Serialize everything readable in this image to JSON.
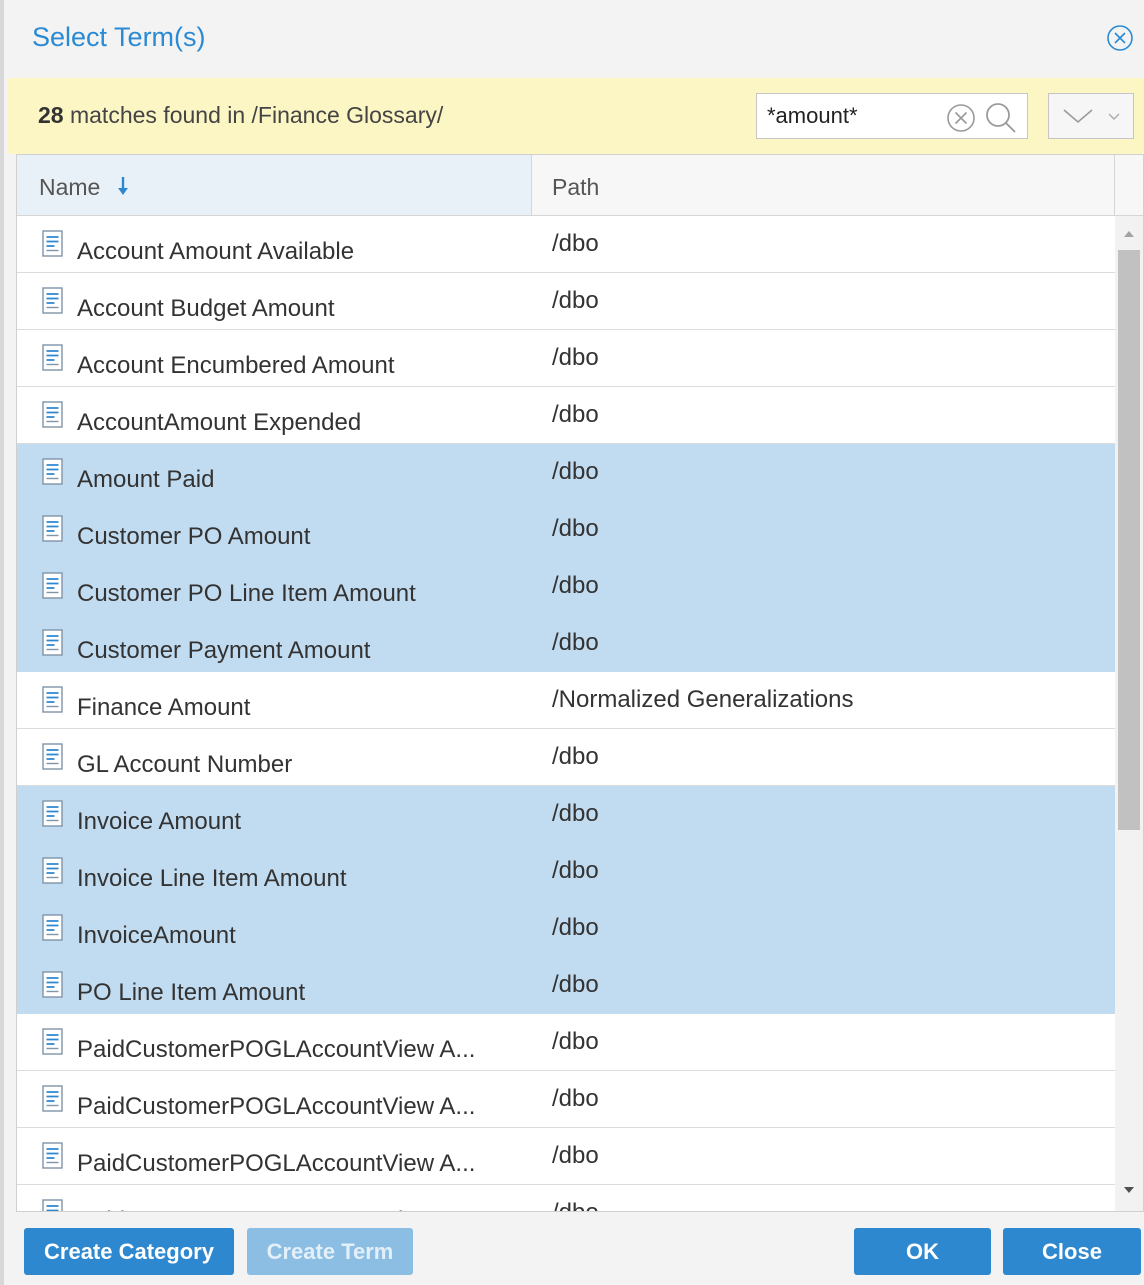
{
  "dialog": {
    "title": "Select Term(s)"
  },
  "info": {
    "count": "28",
    "text": " matches found in /Finance Glossary/"
  },
  "search": {
    "value": "*amount*"
  },
  "grid": {
    "columns": {
      "name": "Name",
      "path": "Path"
    },
    "rows": [
      {
        "name": "Account Amount Available",
        "path": "/dbo",
        "selected": false
      },
      {
        "name": "Account Budget Amount",
        "path": "/dbo",
        "selected": false
      },
      {
        "name": "Account Encumbered Amount",
        "path": "/dbo",
        "selected": false
      },
      {
        "name": "AccountAmount Expended",
        "path": "/dbo",
        "selected": false
      },
      {
        "name": "Amount Paid",
        "path": "/dbo",
        "selected": true
      },
      {
        "name": "Customer PO Amount",
        "path": "/dbo",
        "selected": true
      },
      {
        "name": "Customer PO Line Item Amount",
        "path": "/dbo",
        "selected": true
      },
      {
        "name": "Customer Payment Amount",
        "path": "/dbo",
        "selected": true
      },
      {
        "name": "Finance Amount",
        "path": "/Normalized Generalizations",
        "selected": false
      },
      {
        "name": "GL Account Number",
        "path": "/dbo",
        "selected": false
      },
      {
        "name": "Invoice Amount",
        "path": "/dbo",
        "selected": true
      },
      {
        "name": "Invoice Line Item Amount",
        "path": "/dbo",
        "selected": true
      },
      {
        "name": "InvoiceAmount",
        "path": "/dbo",
        "selected": true
      },
      {
        "name": "PO Line Item Amount",
        "path": "/dbo",
        "selected": true
      },
      {
        "name": "PaidCustomerPOGLAccountView A...",
        "path": "/dbo",
        "selected": false
      },
      {
        "name": "PaidCustomerPOGLAccountView A...",
        "path": "/dbo",
        "selected": false
      },
      {
        "name": "PaidCustomerPOGLAccountView A...",
        "path": "/dbo",
        "selected": false
      },
      {
        "name": "PaidCustomerPOGLAccountView A...",
        "path": "/dbo",
        "selected": false
      }
    ]
  },
  "footer": {
    "create_category": "Create Category",
    "create_term": "Create Term",
    "ok": "OK",
    "close": "Close"
  },
  "colors": {
    "accent": "#2e88d0",
    "title": "#2a8ad4",
    "selected_row": "#c1dbf0",
    "info_bar": "#fbf6c4"
  },
  "icons": {
    "close": "close-circle-icon",
    "clear": "clear-circle-icon",
    "search": "search-icon",
    "sort": "sort-down-arrow-icon",
    "term": "term-document-icon",
    "options": "chevron-down-icon"
  }
}
